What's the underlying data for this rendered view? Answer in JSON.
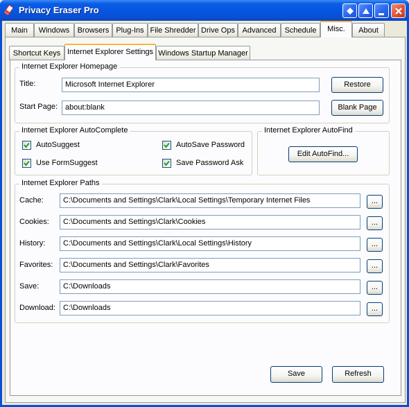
{
  "window": {
    "title": "Privacy Eraser Pro"
  },
  "top_tabs": [
    "Main",
    "Windows",
    "Browsers",
    "Plug-Ins",
    "File Shredder",
    "Drive Ops",
    "Advanced",
    "Schedule",
    "Misc.",
    "About"
  ],
  "active_top_tab": "Misc.",
  "sub_tabs": [
    "Shortcut Keys",
    "Internet Explorer Settings",
    "Windows Startup Manager"
  ],
  "active_sub_tab": "Internet Explorer Settings",
  "homepage": {
    "legend": "Internet Explorer Homepage",
    "title_label": "Title:",
    "title_value": "Microsoft Internet Explorer",
    "start_label": "Start Page:",
    "start_value": "about:blank",
    "restore_button": "Restore",
    "blank_button": "Blank Page"
  },
  "autocomplete": {
    "legend": "Internet Explorer AutoComplete",
    "items": [
      {
        "label": "AutoSuggest",
        "checked": true
      },
      {
        "label": "Use FormSuggest",
        "checked": true
      },
      {
        "label": "AutoSave Password",
        "checked": true
      },
      {
        "label": "Save Password Ask",
        "checked": true
      }
    ]
  },
  "autofind": {
    "legend": "Internet Explorer AutoFind",
    "button": "Edit AutoFind..."
  },
  "paths": {
    "legend": "Internet Explorer Paths",
    "browse_label": "...",
    "rows": [
      {
        "label": "Cache:",
        "value": "C:\\Documents and Settings\\Clark\\Local Settings\\Temporary Internet Files"
      },
      {
        "label": "Cookies:",
        "value": "C:\\Documents and Settings\\Clark\\Cookies"
      },
      {
        "label": "History:",
        "value": "C:\\Documents and Settings\\Clark\\Local Settings\\History"
      },
      {
        "label": "Favorites:",
        "value": "C:\\Documents and Settings\\Clark\\Favorites"
      },
      {
        "label": "Save:",
        "value": "C:\\Downloads"
      },
      {
        "label": "Download:",
        "value": "C:\\Downloads"
      }
    ]
  },
  "footer": {
    "save_button": "Save",
    "refresh_button": "Refresh"
  },
  "colors": {
    "titlebar": "#0556e2",
    "face": "#ece9d8",
    "tab_highlight": "#f9b53b",
    "check": "#21a121"
  }
}
